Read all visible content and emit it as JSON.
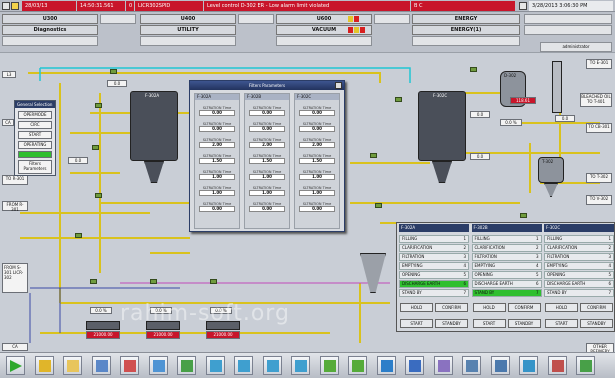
{
  "alarm_bar": {
    "date": "28/03/13",
    "time": "14:50:31.561",
    "priority": "0",
    "tag": "LICR302SPID",
    "message": "Level control D-302 ER - Low alarm limit violated",
    "state": "B C",
    "datetime": "3/28/2013 3:06:30 PM"
  },
  "areas": {
    "u300": "U300",
    "diagnostics": "Diagnostics",
    "u400": "U400",
    "utility": "UTILITY",
    "u600": "U600",
    "vacuum": "VACUUM",
    "energy": "ENERGY",
    "energy1": "ENERGY(1)",
    "user": "administrator"
  },
  "schematic": {
    "f302a": "F-302A",
    "f302c": "F-302C",
    "d302": "D-302",
    "t302": "T-302",
    "level_value": "118.61",
    "to_e": "TO E-301",
    "to_c": "TO CB-301",
    "to_r": "TO R-301",
    "from_r": "FROM R-301",
    "from_s": "FROM S-301 LICR-302",
    "bleach": "BLEACHED OIL TO T-401",
    "to_t": "TO T-302",
    "to_v": "TO V-302",
    "l3": "L3",
    "ca": "CA",
    "bottom_right": "OTHER REFINERY",
    "prod_a": "21000.00",
    "prod_b": "21000.00",
    "prod_c": "21000.00",
    "sp1": "0.0",
    "sp2": "0.0",
    "sp3": "0.0",
    "sp4": "0.0",
    "sp5": "0.0 %",
    "sp6": "0.0 %",
    "sp7": "0.0 %",
    "sp8": "0.0",
    "sp9": "0.0 %"
  },
  "general_selection": {
    "title": "General Selection",
    "opt1": "OPERMODE",
    "opt2": "CIRC",
    "opt3": "START",
    "opt4": "OPERATING",
    "opt5": "Filters Parameters"
  },
  "filters_popup": {
    "title": "Filters Parameters",
    "columns": [
      {
        "name": "F-302A",
        "values": [
          "0.00",
          "0.00",
          "2.00",
          "1.50",
          "1.00",
          "1.00",
          "0.00"
        ]
      },
      {
        "name": "F-302B",
        "values": [
          "0.00",
          "0.00",
          "2.00",
          "1.50",
          "1.00",
          "1.00",
          "0.00"
        ]
      },
      {
        "name": "F-302C",
        "values": [
          "0.00",
          "0.00",
          "2.00",
          "1.50",
          "1.00",
          "1.00",
          "0.00"
        ]
      }
    ],
    "row_labels": [
      "SLTRATION Time",
      "SLTRATION Time",
      "SLTRATION Time",
      "SLTRATION Time",
      "SLTRATION Time",
      "SLTRATION Time",
      "SLTRATION Time"
    ]
  },
  "command_panel": {
    "columns": [
      {
        "name": "F-302A",
        "steps": [
          [
            "FILLING",
            "1"
          ],
          [
            "CLARIFICATION",
            "2"
          ],
          [
            "FILTRATION",
            "3"
          ],
          [
            "EMPTYING",
            "4"
          ],
          [
            "OPENING",
            "5"
          ],
          [
            "DISCHARGE EARTH",
            "6"
          ],
          [
            "STAND BY",
            "7"
          ]
        ],
        "active": 5
      },
      {
        "name": "F-302B",
        "steps": [
          [
            "FILLING",
            "1"
          ],
          [
            "CLARIFICATION",
            "2"
          ],
          [
            "FILTRATION",
            "3"
          ],
          [
            "EMPTYING",
            "4"
          ],
          [
            "OPENING",
            "5"
          ],
          [
            "DISCHARGE EARTH",
            "6"
          ],
          [
            "STAND BY",
            "7"
          ]
        ],
        "active": 6
      },
      {
        "name": "F-302C",
        "steps": [
          [
            "FILLING",
            "1"
          ],
          [
            "CLARIFICATION",
            "2"
          ],
          [
            "FILTRATION",
            "3"
          ],
          [
            "EMPTYING",
            "4"
          ],
          [
            "OPENING",
            "5"
          ],
          [
            "DISCHARGE EARTH",
            "6"
          ],
          [
            "STAND BY",
            "7"
          ]
        ],
        "active": -1
      }
    ],
    "hold": "HOLD",
    "confirm": "CONFIRM",
    "start": "START",
    "standby": "STANDBY"
  },
  "toolbar": {
    "tools": [
      "play-icon",
      "alarm-icon",
      "folder-icon",
      "window-icon",
      "chart-icon",
      "report-icon",
      "export-icon",
      "nav-left-icon",
      "nav-up-icon",
      "nav-down-icon",
      "nav-right-icon",
      "nav-back-icon",
      "nav-fwd-icon",
      "refresh-icon",
      "save-icon",
      "user-icon",
      "print-icon",
      "screen-icon",
      "help-icon",
      "trend-icon",
      "signature-icon"
    ]
  },
  "watermark": "rahim-soft.org",
  "colors": {
    "alarm": "#c8152a",
    "pipe_yellow": "#d9c21d",
    "pipe_cyan": "#20c6d4",
    "pipe_blue": "#3b4aa6",
    "vessel": "#4a4f59",
    "active_step": "#2fbf2f"
  }
}
